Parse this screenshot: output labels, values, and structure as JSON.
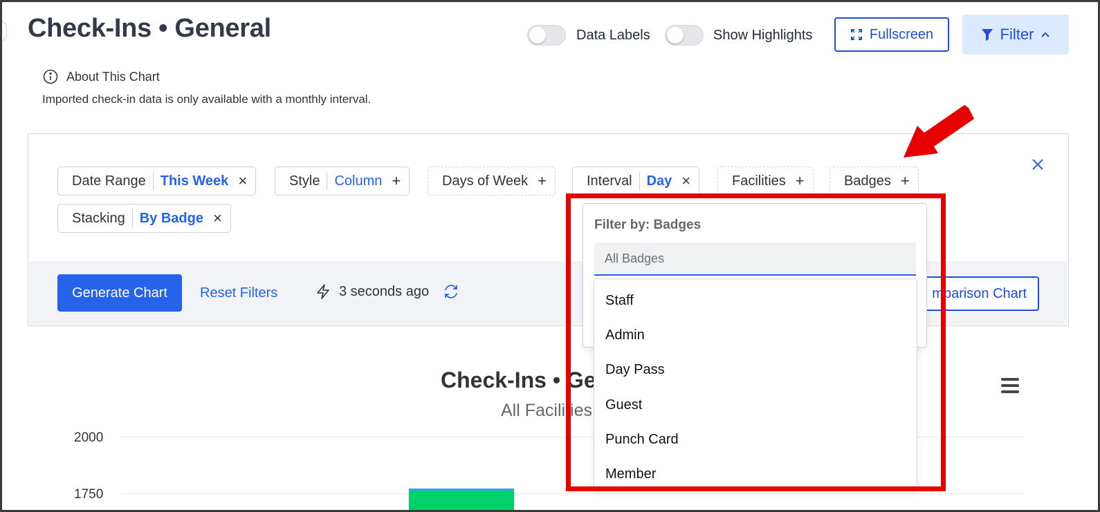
{
  "header": {
    "title": "Check-Ins • General",
    "data_labels_toggle": "Data Labels",
    "show_highlights_toggle": "Show Highlights",
    "fullscreen_label": "Fullscreen",
    "filter_label": "Filter"
  },
  "about": {
    "heading": "About This Chart",
    "text": "Imported check-in data is only available with a monthly interval."
  },
  "filters": {
    "chips": [
      {
        "label": "Date Range",
        "value": "This Week",
        "action": "×"
      },
      {
        "label": "Style",
        "value": "Column",
        "action": "+"
      },
      {
        "label": "Days of Week",
        "value": "",
        "action": "+"
      },
      {
        "label": "Interval",
        "value": "Day",
        "action": "×"
      },
      {
        "label": "Facilities",
        "value": "",
        "action": "+"
      },
      {
        "label": "Badges",
        "value": "",
        "action": "+"
      },
      {
        "label": "Stacking",
        "value": "By Badge",
        "action": "×"
      }
    ]
  },
  "actions": {
    "generate": "Generate Chart",
    "reset": "Reset Filters",
    "status": "3 seconds ago",
    "comparison": "mparison Chart"
  },
  "dropdown": {
    "title": "Filter by: Badges",
    "placeholder": "All Badges",
    "options": [
      "Staff",
      "Admin",
      "Day Pass",
      "Guest",
      "Punch Card",
      "Member"
    ]
  },
  "chart": {
    "title": "Check-Ins • Ge",
    "subtitle": "All Facilities",
    "yticks": [
      "2000",
      "1750"
    ]
  },
  "colors": {
    "accent": "#2563eb",
    "highlight": "#e60000",
    "bar": "#00d26a"
  }
}
